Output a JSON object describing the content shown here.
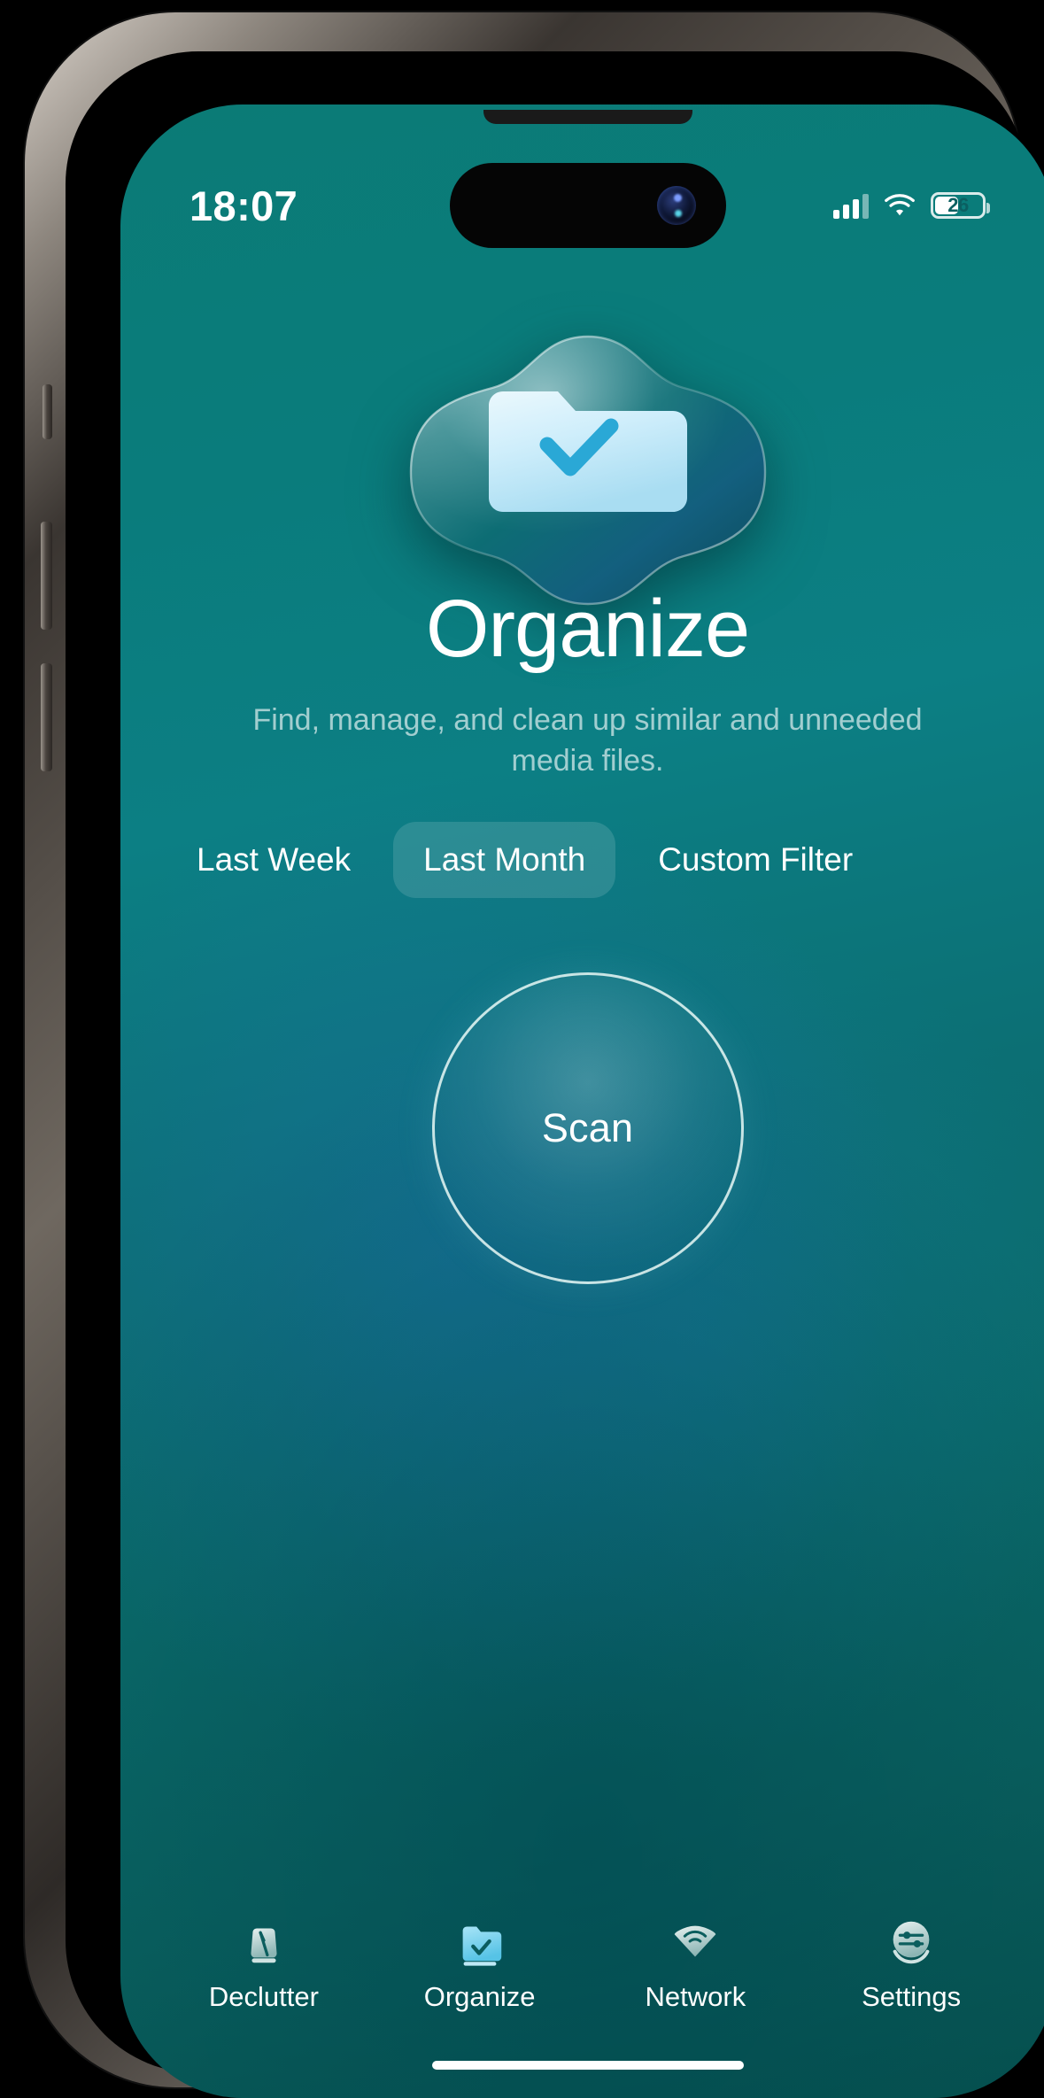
{
  "status_bar": {
    "time": "18:07",
    "signal_icon": "cellular-signal-icon",
    "wifi_icon": "wifi-icon",
    "battery_icon": "battery-icon",
    "battery_percent": "26"
  },
  "hero": {
    "icon": "glossy-folder-check-icon"
  },
  "header": {
    "title": "Organize",
    "subtitle": "Find, manage, and clean up similar and unneeded media files."
  },
  "filters": {
    "selected": "Last Month",
    "options": [
      {
        "label": "Last Week",
        "selected": false
      },
      {
        "label": "Last Month",
        "selected": true
      },
      {
        "label": "Custom Filter",
        "selected": false
      }
    ]
  },
  "scan": {
    "label": "Scan"
  },
  "tabbar": {
    "active": "Organize",
    "items": [
      {
        "label": "Declutter",
        "icon": "broom-icon",
        "active": false
      },
      {
        "label": "Organize",
        "icon": "folder-check-icon",
        "active": true
      },
      {
        "label": "Network",
        "icon": "wifi-signal-icon",
        "active": false
      },
      {
        "label": "Settings",
        "icon": "sliders-circle-icon",
        "active": false
      }
    ]
  },
  "colors": {
    "background_teal": "#0a7c7c",
    "background_teal_dark": "#06514e",
    "accent_blue": "#7fd4ef",
    "text_primary": "#ffffff",
    "text_secondary": "rgba(255,255,255,0.62)"
  }
}
